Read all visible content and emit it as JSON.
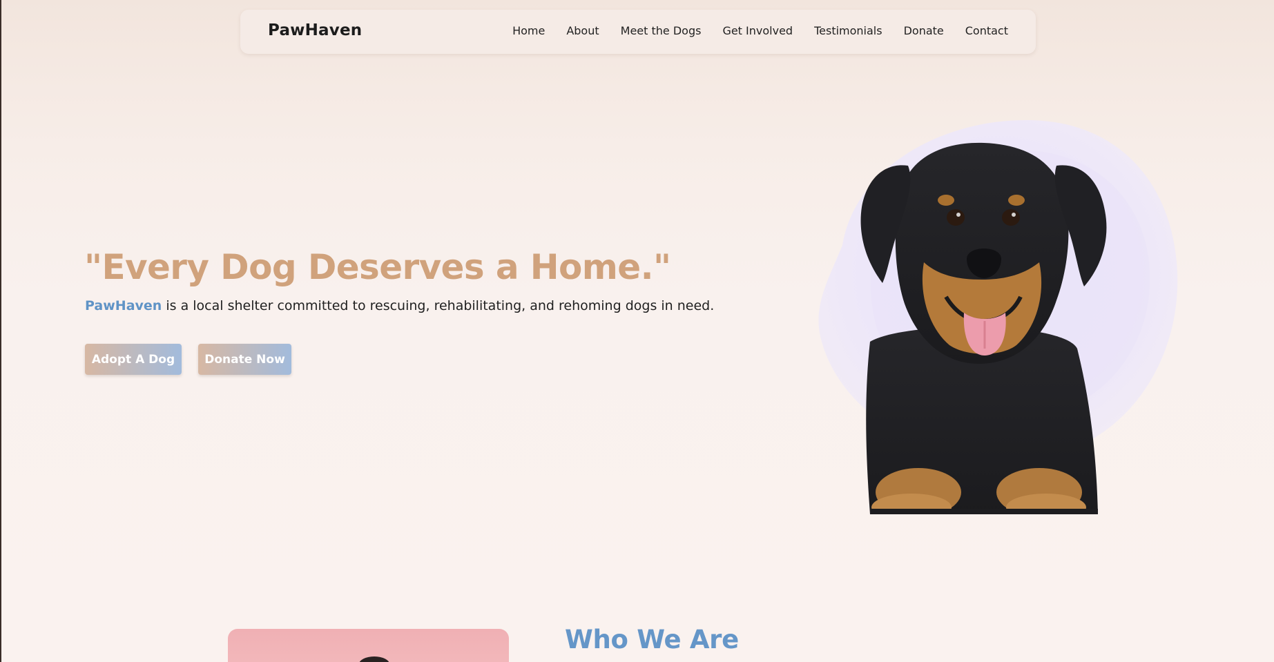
{
  "nav": {
    "brand": "PawHaven",
    "links": [
      "Home",
      "About",
      "Meet the Dogs",
      "Get Involved",
      "Testimonials",
      "Donate",
      "Contact"
    ]
  },
  "hero": {
    "title": "\"Every Dog Deserves a Home.\"",
    "brand_inline": "PawHaven",
    "subtitle_rest": " is a local shelter committed to rescuing, rehabilitating, and rehoming dogs in need.",
    "buttons": {
      "adopt": "Adopt A Dog",
      "donate": "Donate Now"
    }
  },
  "about": {
    "title": "Who We Are"
  },
  "colors": {
    "hero_title": "#d0a27c",
    "accent_blue": "#6596c8",
    "button_gradient_start": "#d7b8a3",
    "button_gradient_end": "#a2bbdc",
    "navbar_bg": "#f5ebe6",
    "blob_lavender": "#ece6f9"
  },
  "icons": {
    "hero_image": "rottweiler-puppy-photo"
  }
}
